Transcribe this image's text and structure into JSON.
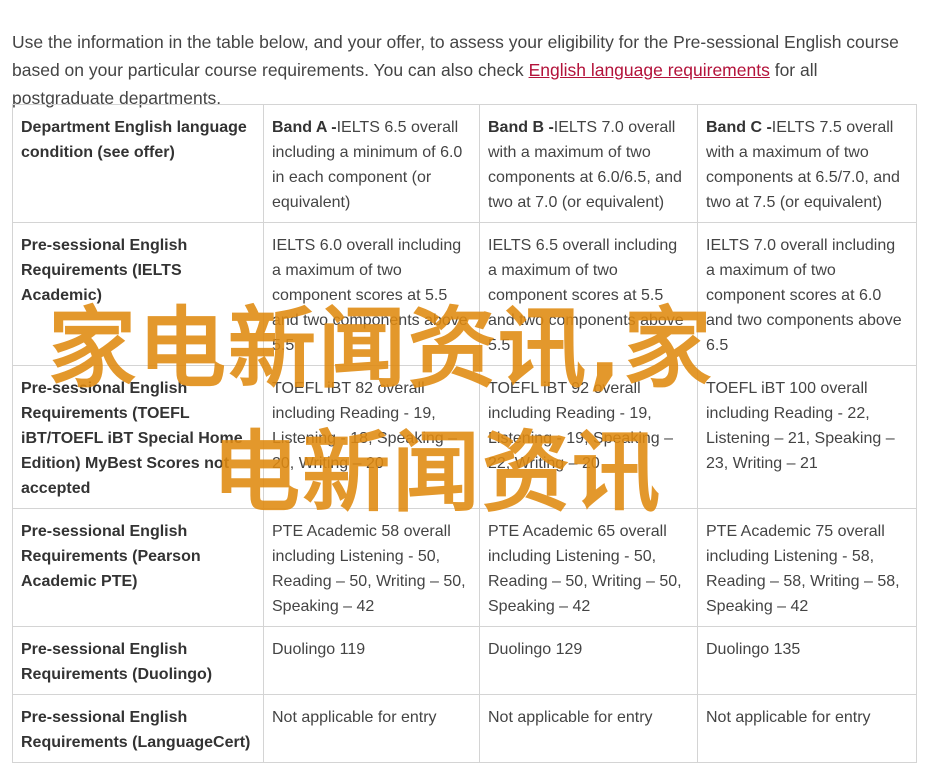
{
  "intro": {
    "text_before": "Use the information in the table below, and your offer, to assess your eligibility for the Pre-sessional English course based on your particular course requirements. You can also check ",
    "link_text": "English language requirements",
    "text_after": " for all postgraduate departments."
  },
  "table": {
    "rows": [
      {
        "header": "Department English language condition (see offer)",
        "cells": [
          {
            "band": "Band A -",
            "text": "IELTS 6.5 overall including a minimum of 6.0 in each component (or equivalent)"
          },
          {
            "band": "Band B -",
            "text": "IELTS 7.0 overall with a maximum of two components at 6.0/6.5, and two at 7.0 (or equivalent)"
          },
          {
            "band": "Band C -",
            "text": "IELTS 7.5 overall with a maximum of two components at 6.5/7.0, and two at 7.5 (or equivalent)"
          }
        ]
      },
      {
        "header": "Pre-sessional English Requirements (IELTS Academic)",
        "cells": [
          {
            "band": "",
            "text": "IELTS 6.0 overall including a maximum of two component scores at 5.5 and two components above 5.5"
          },
          {
            "band": "",
            "text": "IELTS 6.5 overall including a maximum of two component scores at 5.5 and two components above 5.5"
          },
          {
            "band": "",
            "text": "IELTS 7.0 overall including a maximum of two component scores at 6.0 and two components above 6.5"
          }
        ]
      },
      {
        "header": "Pre-sessional English Requirements (TOEFL iBT/TOEFL iBT Special Home Edition) MyBest Scores not accepted",
        "cells": [
          {
            "band": "",
            "text": "TOEFL iBT 82 overall including Reading - 19, Listening - 18, Speaking – 20, Writing – 20"
          },
          {
            "band": "",
            "text": "TOEFL iBT 92 overall including Reading - 19, Listening - 19, Speaking – 22, Writing – 20"
          },
          {
            "band": "",
            "text": "TOEFL iBT 100 overall including Reading - 22, Listening – 21, Speaking – 23, Writing – 21"
          }
        ]
      },
      {
        "header": "Pre-sessional English Requirements (Pearson Academic PTE)",
        "cells": [
          {
            "band": "",
            "text": "PTE Academic 58 overall including Listening - 50, Reading – 50, Writing – 50, Speaking – 42"
          },
          {
            "band": "",
            "text": "PTE Academic 65 overall including Listening - 50, Reading – 50, Writing – 50, Speaking – 42"
          },
          {
            "band": "",
            "text": "PTE Academic 75 overall including Listening - 58, Reading – 58, Writing – 58, Speaking – 42"
          }
        ]
      },
      {
        "header": "Pre-sessional English Requirements (Duolingo)",
        "cells": [
          {
            "band": "",
            "text": "Duolingo 119"
          },
          {
            "band": "",
            "text": "Duolingo 129"
          },
          {
            "band": "",
            "text": "Duolingo 135"
          }
        ]
      },
      {
        "header": "Pre-sessional English Requirements (LanguageCert)",
        "cells": [
          {
            "band": "",
            "text": "Not applicable for entry"
          },
          {
            "band": "",
            "text": "Not applicable for entry"
          },
          {
            "band": "",
            "text": "Not applicable for entry"
          }
        ]
      }
    ]
  },
  "watermark": {
    "line1": "家电新闻资讯,家",
    "line2": "电新闻资讯",
    "color": "#e08a10"
  }
}
